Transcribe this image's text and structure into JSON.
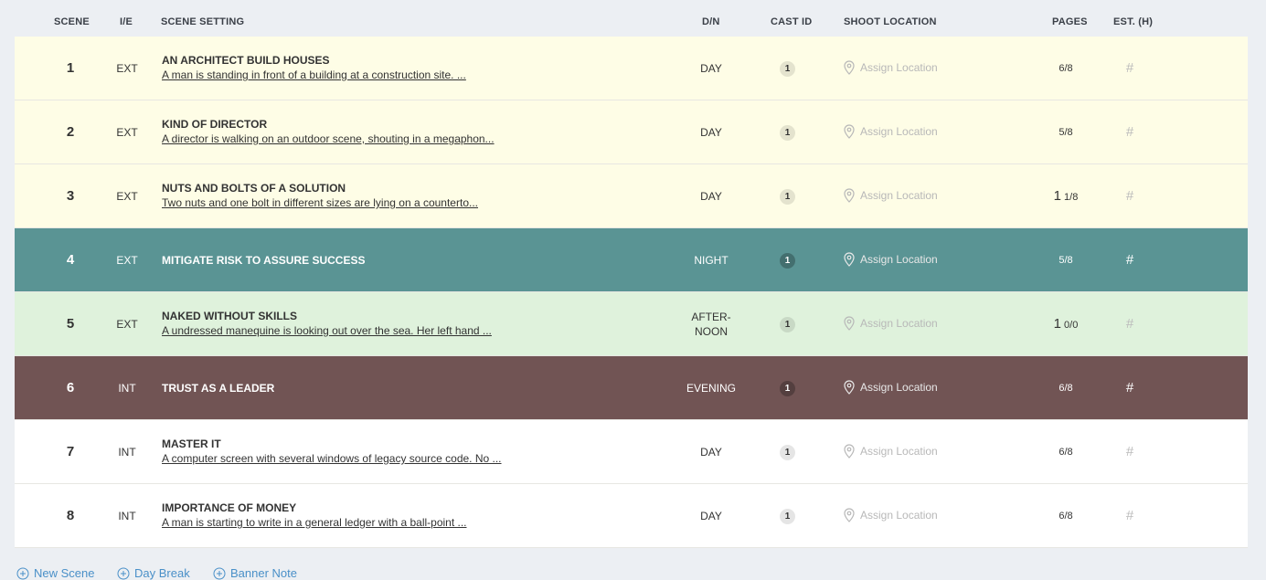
{
  "header": {
    "scene": "SCENE",
    "ie": "I/E",
    "setting": "SCENE SETTING",
    "dn": "D/N",
    "cast": "CAST ID",
    "location": "SHOOT LOCATION",
    "pages": "PAGES",
    "est": "EST. (H)"
  },
  "colors": {
    "yellow_row": "#fefde6",
    "teal_row": "#5a9494",
    "green_row": "#dff2dc",
    "brown_row": "#715454",
    "white_row": "#ffffff",
    "link_blue": "#4a90c8"
  },
  "rows": [
    {
      "num": "1",
      "ie": "EXT",
      "title": "AN ARCHITECT BUILD HOUSES",
      "desc": "A man is standing in front of a building at a construction site. ...",
      "dn": "DAY",
      "cast": "1",
      "location": "Assign Location",
      "pages_whole": "",
      "pages_frac": "6/8",
      "est": "#",
      "bg": "#fefde6",
      "theme": "light"
    },
    {
      "num": "2",
      "ie": "EXT",
      "title": "KIND OF DIRECTOR",
      "desc": "A director is walking on an outdoor scene, shouting in a megaphon...",
      "dn": "DAY",
      "cast": "1",
      "location": "Assign Location",
      "pages_whole": "",
      "pages_frac": "5/8",
      "est": "#",
      "bg": "#fefde6",
      "theme": "light"
    },
    {
      "num": "3",
      "ie": "EXT",
      "title": "NUTS AND BOLTS OF A SOLUTION",
      "desc": "Two nuts and one bolt in different sizes are lying on a counterto...",
      "dn": "DAY",
      "cast": "1",
      "location": "Assign Location",
      "pages_whole": "1",
      "pages_frac": "1/8",
      "est": "#",
      "bg": "#fefde6",
      "theme": "light"
    },
    {
      "num": "4",
      "ie": "EXT",
      "title": "MITIGATE RISK TO ASSURE SUCCESS",
      "desc": "",
      "dn": "NIGHT",
      "cast": "1",
      "location": "Assign Location",
      "pages_whole": "",
      "pages_frac": "5/8",
      "est": "#",
      "bg": "#5a9494",
      "theme": "dark"
    },
    {
      "num": "5",
      "ie": "EXT",
      "title": "NAKED WITHOUT SKILLS",
      "desc": "A undressed manequine is looking out over the sea. Her left hand ...",
      "dn": "AFTER-NOON",
      "cast": "1",
      "location": "Assign Location",
      "pages_whole": "1",
      "pages_frac": "0/0",
      "est": "#",
      "bg": "#dff2dc",
      "theme": "light"
    },
    {
      "num": "6",
      "ie": "INT",
      "title": "TRUST AS A LEADER",
      "desc": "",
      "dn": "EVENING",
      "cast": "1",
      "location": "Assign Location",
      "pages_whole": "",
      "pages_frac": "6/8",
      "est": "#",
      "bg": "#715454",
      "theme": "dark"
    },
    {
      "num": "7",
      "ie": "INT",
      "title": "MASTER IT",
      "desc": "A computer screen with several windows of legacy source code. No ...",
      "dn": "DAY",
      "cast": "1",
      "location": "Assign Location",
      "pages_whole": "",
      "pages_frac": "6/8",
      "est": "#",
      "bg": "#ffffff",
      "theme": "light"
    },
    {
      "num": "8",
      "ie": "INT",
      "title": "IMPORTANCE OF MONEY",
      "desc": "A man is starting to write in a general ledger with a ball-point ...",
      "dn": "DAY",
      "cast": "1",
      "location": "Assign Location",
      "pages_whole": "",
      "pages_frac": "6/8",
      "est": "#",
      "bg": "#ffffff",
      "theme": "light"
    }
  ],
  "footer": {
    "new_scene": "New Scene",
    "day_break": "Day Break",
    "banner_note": "Banner Note"
  }
}
